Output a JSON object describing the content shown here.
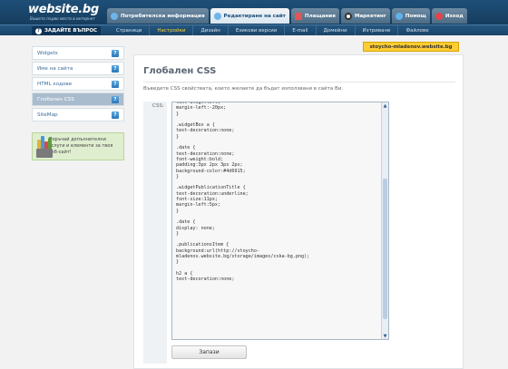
{
  "brand": {
    "logo": "website.bg",
    "tagline": "Вашето първо място в интернет"
  },
  "tabs": [
    {
      "label": "Потребителска информация",
      "icon": "gear-icon",
      "color": "#6fb6e8"
    },
    {
      "label": "Редактиране на сайт",
      "icon": "gear-icon",
      "color": "#6fb6e8"
    },
    {
      "label": "Плащания",
      "icon": "calendar-icon",
      "color": "#e05555"
    },
    {
      "label": "Маркетинг",
      "icon": "target-icon",
      "color": "#333333"
    },
    {
      "label": "Помощ",
      "icon": "help-icon",
      "color": "#5fb3e8"
    },
    {
      "label": "Изход",
      "icon": "power-icon",
      "color": "#e44444"
    }
  ],
  "ask_label": "ЗАДАЙТЕ ВЪПРОС",
  "subnav": [
    "Страници",
    "Настройки",
    "Дизайн",
    "Езикови версии",
    "E-mail",
    "Домейни",
    "Изтриване",
    "Файлове"
  ],
  "site_badge": "stoycho-mladenov.website.bg",
  "sidebar": [
    {
      "label": "Widgets"
    },
    {
      "label": "Име на сайта"
    },
    {
      "label": "HTML кодове"
    },
    {
      "label": "Глобален CSS"
    },
    {
      "label": "SiteMap"
    }
  ],
  "promo": "Поръчай допълнителни услуги и елементи за твоя уеб-сайт!",
  "page_title": "Глобален CSS",
  "description": "Въведете CSS свойствата, които желаете да бъдат използвани в сайта Ви.",
  "css_label": "CSS:",
  "css_code": "text-align:left;\nmargin-left:-20px;\n}\n\n.widgetBox a {\ntext-decoration:none;\n}\n\n.date {\ntext-decoration:none;\nfont-weight:bold;\npadding:3px 2px 3px 2px;\nbackground-color:#4d6915;\n}\n\n.widgetPublicationTitle {\ntext-decoration:underline;\nfont-size:11px;\nmargin-left:5px;\n}\n\n.date {\ndisplay: none;\n}\n\n.publicationsItem {\nbackground:url(http://stoycho-\nmladenov.website.bg/storage/images/cska-bg.png);\n}\n\nh2 a {\ntext-decoration:none;",
  "save_label": "Запази",
  "colors": {
    "header": "#1e4f78",
    "accent": "#ffcc33",
    "active_sidebar": "#a9bccd"
  }
}
